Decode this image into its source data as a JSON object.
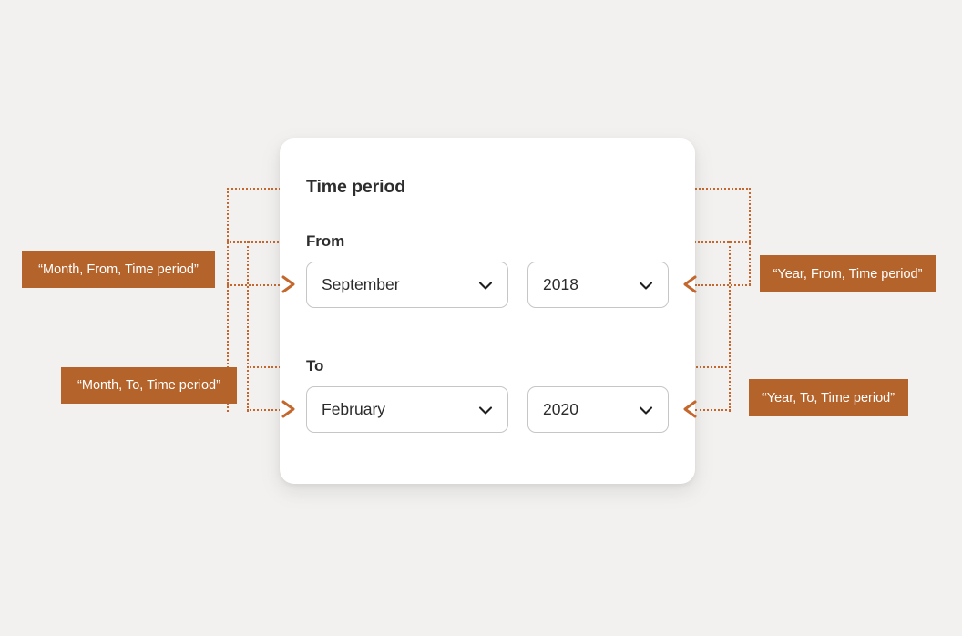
{
  "page": {
    "background_color": "#f2f1ef",
    "accent_color": "#b4632b",
    "line_color": "#c4672d"
  },
  "card": {
    "title": "Time period",
    "groups": [
      {
        "label": "From",
        "month": {
          "value": "September",
          "icon": "chevron-down-icon"
        },
        "year": {
          "value": "2018",
          "icon": "chevron-down-icon"
        }
      },
      {
        "label": "To",
        "month": {
          "value": "February",
          "icon": "chevron-down-icon"
        },
        "year": {
          "value": "2020",
          "icon": "chevron-down-icon"
        }
      }
    ]
  },
  "annotations": [
    {
      "id": "month-from",
      "text": "“Month, From, Time period”"
    },
    {
      "id": "month-to",
      "text": "“Month, To, Time period”"
    },
    {
      "id": "year-from",
      "text": "“Year, From, Time period”"
    },
    {
      "id": "year-to",
      "text": "“Year, To, Time period”"
    }
  ]
}
